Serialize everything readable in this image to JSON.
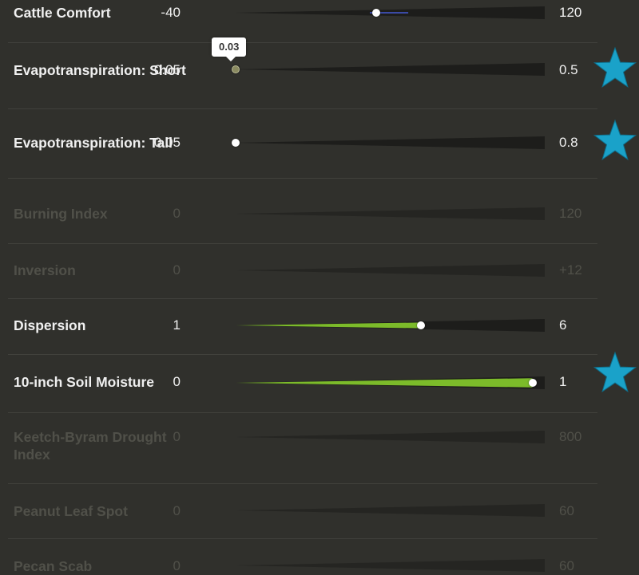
{
  "colors": {
    "background": "#30302c",
    "track": "#1d1d1b",
    "fill_green": "#7cbb2a",
    "fill_blue": "#3b4aa5",
    "star": "#1aa2c9",
    "knob": "#ffffff"
  },
  "rows": [
    {
      "label": "Cattle Comfort",
      "min": "-40",
      "max": "120",
      "level": 0.455,
      "fill": "blue",
      "enabled": true,
      "starred": false
    },
    {
      "label": "Evapotranspiration: Short",
      "min": "0.05",
      "max": "0.5",
      "level": 0.0,
      "fill": "none",
      "enabled": true,
      "starred": true,
      "tooltip": "0.03"
    },
    {
      "label": "Evapotranspiration: Tall",
      "min": "0.05",
      "max": "0.8",
      "level": 0.0,
      "fill": "none",
      "enabled": true,
      "starred": true
    },
    {
      "label": "Burning Index",
      "min": "0",
      "max": "120",
      "level": 0.0,
      "fill": "none",
      "enabled": false,
      "starred": false
    },
    {
      "label": "Inversion",
      "min": "0",
      "max": "+12",
      "level": 0.0,
      "fill": "none",
      "enabled": false,
      "starred": false
    },
    {
      "label": "Dispersion",
      "min": "1",
      "max": "6",
      "level": 0.6,
      "fill": "green",
      "enabled": true,
      "starred": false
    },
    {
      "label": "10-inch Soil Moisture",
      "min": "0",
      "max": "1",
      "level": 0.96,
      "fill": "green",
      "enabled": true,
      "starred": true
    },
    {
      "label": "Keetch-Byram Drought Index",
      "min": "0",
      "max": "800",
      "level": 0.0,
      "fill": "none",
      "enabled": false,
      "starred": false
    },
    {
      "label": "Peanut Leaf Spot",
      "min": "0",
      "max": "60",
      "level": 0.0,
      "fill": "none",
      "enabled": false,
      "starred": false
    },
    {
      "label": "Pecan Scab",
      "min": "0",
      "max": "60",
      "level": 0.0,
      "fill": "none",
      "enabled": false,
      "starred": false
    }
  ]
}
